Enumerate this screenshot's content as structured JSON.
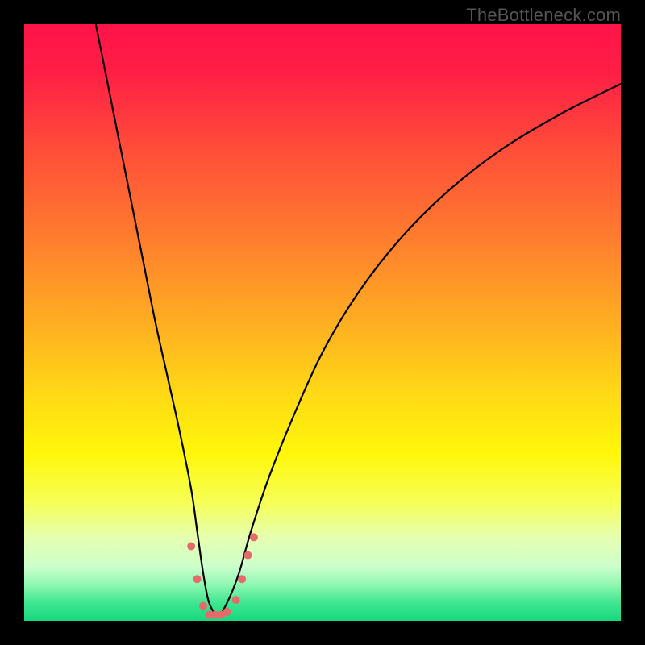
{
  "watermark": "TheBottleneck.com",
  "chart_data": {
    "type": "line",
    "title": "",
    "xlabel": "",
    "ylabel": "",
    "xlim": [
      0,
      100
    ],
    "ylim": [
      0,
      100
    ],
    "grid": false,
    "legend": false,
    "background_gradient": {
      "stops": [
        {
          "offset": 0.0,
          "color": "#ff1448"
        },
        {
          "offset": 0.08,
          "color": "#ff1e46"
        },
        {
          "offset": 0.2,
          "color": "#ff4a3a"
        },
        {
          "offset": 0.35,
          "color": "#ff7a2f"
        },
        {
          "offset": 0.5,
          "color": "#ffae22"
        },
        {
          "offset": 0.62,
          "color": "#ffd916"
        },
        {
          "offset": 0.72,
          "color": "#fff70a"
        },
        {
          "offset": 0.8,
          "color": "#f6ff55"
        },
        {
          "offset": 0.86,
          "color": "#e6ffb0"
        },
        {
          "offset": 0.91,
          "color": "#ccffcc"
        },
        {
          "offset": 0.94,
          "color": "#8cf7b0"
        },
        {
          "offset": 0.97,
          "color": "#3fe691"
        },
        {
          "offset": 1.0,
          "color": "#17d87d"
        }
      ]
    },
    "series": [
      {
        "name": "bottleneck-curve",
        "type": "line",
        "color": "#000000",
        "x": [
          12,
          14,
          16,
          18,
          20,
          22,
          24,
          26,
          28,
          29,
          30,
          31,
          32.5,
          34,
          36,
          38,
          41,
          45,
          50,
          56,
          63,
          71,
          80,
          90,
          100
        ],
        "y": [
          100,
          90,
          80,
          70,
          60,
          50,
          41,
          32,
          22,
          15,
          8,
          3,
          1,
          3,
          8,
          15,
          24,
          34,
          45,
          55,
          64,
          72,
          79,
          85,
          90
        ]
      },
      {
        "name": "highlight-dots",
        "type": "scatter",
        "color": "#e76a6a",
        "size": 10,
        "x": [
          28.0,
          29.0,
          30.0,
          31.0,
          32.0,
          33.0,
          34.0,
          35.5,
          36.5,
          37.5,
          38.5
        ],
        "y": [
          12.5,
          7.0,
          2.5,
          1.0,
          1.0,
          1.0,
          1.5,
          3.5,
          7.0,
          11.0,
          14.0
        ]
      }
    ]
  }
}
